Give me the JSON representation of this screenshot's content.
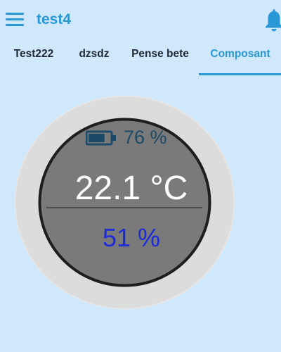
{
  "header": {
    "title": "test4",
    "menu_icon": "hamburger-menu-icon",
    "notification_icon": "bell-icon"
  },
  "tabs": [
    {
      "label": "Test222",
      "active": false
    },
    {
      "label": "dzsdz",
      "active": false
    },
    {
      "label": "Pense bete",
      "active": false
    },
    {
      "label": "Composant",
      "active": true
    }
  ],
  "gauge": {
    "battery_icon": "battery-icon",
    "battery_level": 0.76,
    "battery_text": "76 %",
    "temperature_text": "22.1 °C",
    "humidity_text": "51 %"
  },
  "colors": {
    "background": "#cfe8fb",
    "accent": "#2a98d6",
    "tab_text": "#1f2a36",
    "gauge_outer_ring": "#dcdcdc",
    "gauge_face": "#7a7a7a",
    "gauge_border": "#1e1e1e",
    "battery_color": "#1c4a66",
    "temperature_color": "#ffffff",
    "humidity_color": "#1c2bd9"
  }
}
